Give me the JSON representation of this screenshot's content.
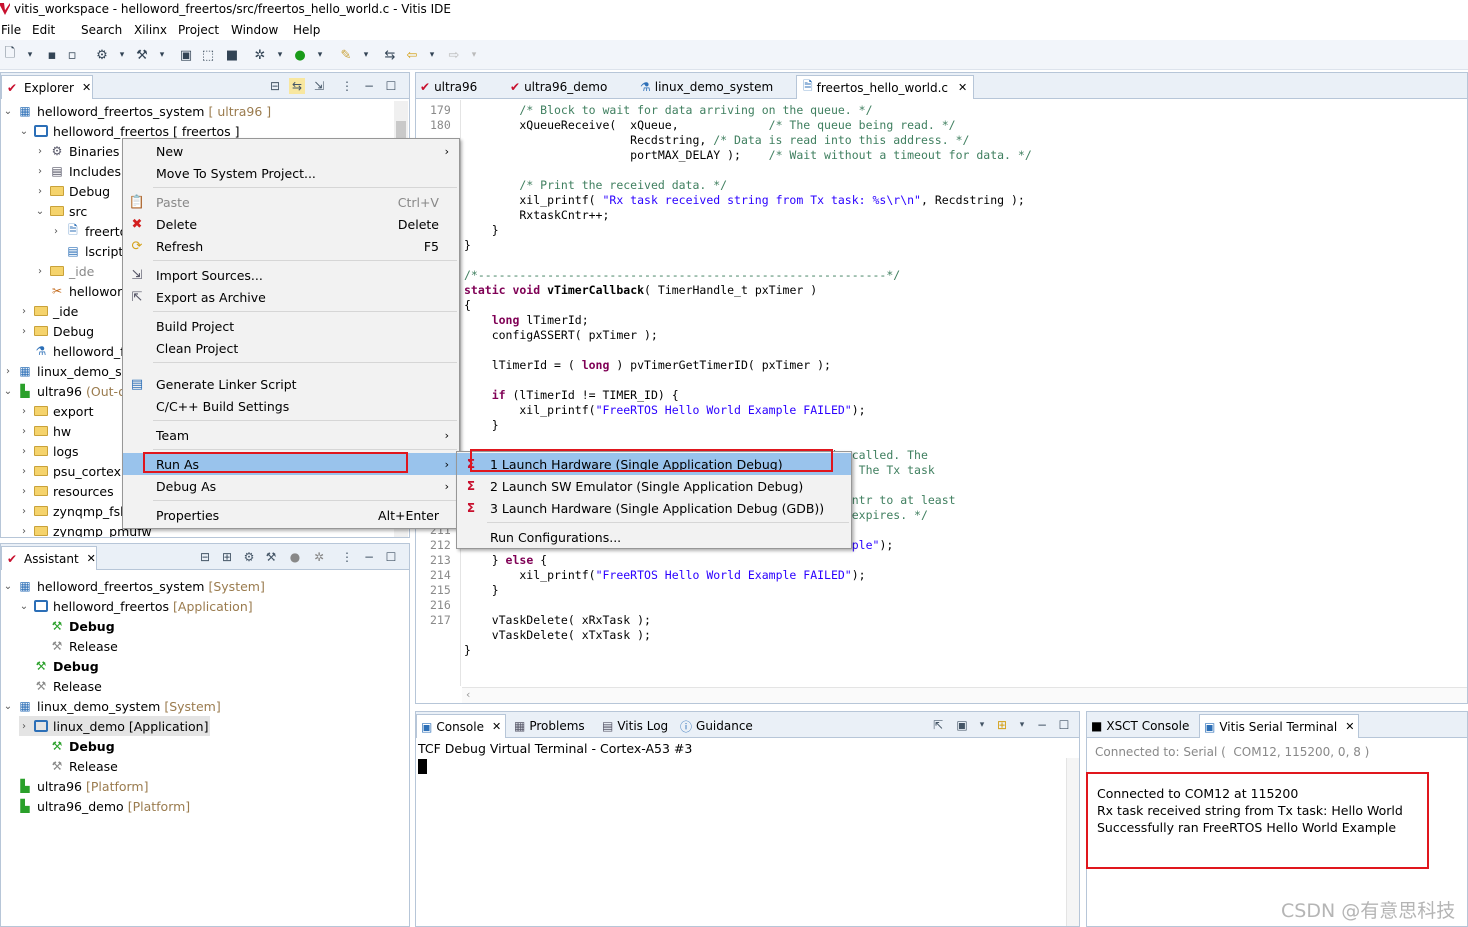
{
  "window": {
    "title": "vitis_workspace - helloword_freertos/src/freertos_hello_world.c - Vitis IDE"
  },
  "menubar": [
    "File",
    "Edit",
    "Search",
    "Xilinx",
    "Project",
    "Window",
    "Help"
  ],
  "explorer": {
    "tab_label": "Explorer",
    "rows": [
      {
        "label": "helloword_freertos_system",
        "suffix": "[ ultra96 ]"
      },
      {
        "label": "helloword_freertos [ freertos ]",
        "suffix": ""
      },
      {
        "label": "Binaries",
        "suffix": ""
      },
      {
        "label": "Includes",
        "suffix": ""
      },
      {
        "label": "Debug",
        "suffix": ""
      },
      {
        "label": "src",
        "suffix": ""
      },
      {
        "label": "freerto",
        "suffix": ""
      },
      {
        "label": "lscript",
        "suffix": ""
      },
      {
        "label": "_ide",
        "suffix": ""
      },
      {
        "label": "hellowor",
        "suffix": ""
      },
      {
        "label": "_ide",
        "suffix": ""
      },
      {
        "label": "Debug",
        "suffix": ""
      },
      {
        "label": "helloword_f",
        "suffix": ""
      },
      {
        "label": "linux_demo_sy",
        "suffix": ""
      },
      {
        "label": "ultra96",
        "suffix": "(Out-o"
      },
      {
        "label": "export",
        "suffix": ""
      },
      {
        "label": "hw",
        "suffix": ""
      },
      {
        "label": "logs",
        "suffix": ""
      },
      {
        "label": "psu_cortexr",
        "suffix": ""
      },
      {
        "label": "resources",
        "suffix": ""
      },
      {
        "label": "zynqmp_fsb",
        "suffix": ""
      },
      {
        "label": "zynqmp_pmufw",
        "suffix": ""
      }
    ]
  },
  "assistant": {
    "tab_label": "Assistant",
    "rows": [
      {
        "label": "helloword_freertos_system",
        "suffix": "[System]"
      },
      {
        "label": "helloword_freertos",
        "suffix": "[Application]"
      },
      {
        "label": "Debug",
        "suffix": ""
      },
      {
        "label": "Release",
        "suffix": ""
      },
      {
        "label": "Debug",
        "suffix": ""
      },
      {
        "label": "Release",
        "suffix": ""
      },
      {
        "label": "linux_demo_system",
        "suffix": "[System]"
      },
      {
        "label": "linux_demo [Application]",
        "suffix": ""
      },
      {
        "label": "Debug",
        "suffix": ""
      },
      {
        "label": "Release",
        "suffix": ""
      },
      {
        "label": "ultra96",
        "suffix": "[Platform]"
      },
      {
        "label": "ultra96_demo",
        "suffix": "[Platform]"
      }
    ]
  },
  "editor": {
    "tabs": [
      "ultra96",
      "ultra96_demo",
      "linux_demo_system",
      "freertos_hello_world.c"
    ]
  },
  "context_menu": {
    "items": [
      {
        "label": "New",
        "shortcut": ""
      },
      {
        "label": "Move To System Project...",
        "shortcut": ""
      },
      {
        "label": "Paste",
        "shortcut": "Ctrl+V"
      },
      {
        "label": "Delete",
        "shortcut": "Delete"
      },
      {
        "label": "Refresh",
        "shortcut": "F5"
      },
      {
        "label": "Import Sources...",
        "shortcut": ""
      },
      {
        "label": "Export as Archive",
        "shortcut": ""
      },
      {
        "label": "Build Project",
        "shortcut": ""
      },
      {
        "label": "Clean Project",
        "shortcut": ""
      },
      {
        "label": "Generate Linker Script",
        "shortcut": ""
      },
      {
        "label": "C/C++ Build Settings",
        "shortcut": ""
      },
      {
        "label": "Team",
        "shortcut": ""
      },
      {
        "label": "Run As",
        "shortcut": ""
      },
      {
        "label": "Debug As",
        "shortcut": ""
      },
      {
        "label": "Properties",
        "shortcut": "Alt+Enter"
      }
    ]
  },
  "submenu": {
    "items": [
      "1 Launch Hardware (Single Application Debug)",
      "2 Launch SW Emulator (Single Application Debug)",
      "3 Launch Hardware (Single Application Debug (GDB))",
      "Run Configurations..."
    ]
  },
  "console": {
    "tabs": [
      "Console",
      "Problems",
      "Vitis Log",
      "Guidance"
    ],
    "title": "TCF Debug Virtual Terminal - Cortex-A53 #3"
  },
  "serial": {
    "tabs": [
      "XSCT Console",
      "Vitis Serial Terminal"
    ],
    "status": "Connected to: Serial (  COM12, 115200, 0, 8 )",
    "lines": [
      "Connected to COM12 at 115200",
      "Rx task received string from Tx task: Hello World",
      "Successfully ran FreeRTOS Hello World Example"
    ]
  },
  "watermark": "CSDN @有意思科技",
  "colors": {
    "accent": "#e0161d",
    "selection": "#99c3ec",
    "tab_bg": "#eaf0f7",
    "keyword": "#7f0055",
    "comment": "#3f7f5f",
    "string": "#2a00ff"
  }
}
